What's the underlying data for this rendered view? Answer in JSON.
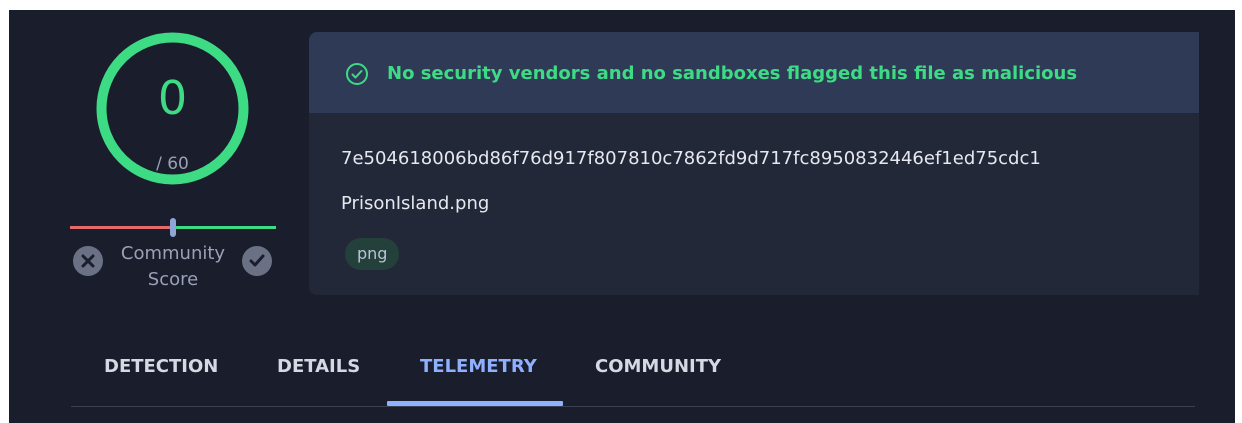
{
  "score": {
    "detections": "0",
    "total": "/ 60",
    "ring_color": "#3ddc84"
  },
  "community": {
    "label_line1": "Community",
    "label_line2": "Score",
    "downvote_icon": "close-icon",
    "upvote_icon": "check-icon"
  },
  "summary": {
    "verdict": "No security vendors and no sandboxes flagged this file as malicious",
    "verdict_icon": "check-circle-icon",
    "verdict_color": "#3ddc84",
    "hash": "7e504618006bd86f76d917f807810c7862fd9d717fc8950832446ef1ed75cdc1",
    "filename": "PrisonIsland.png",
    "tags": [
      "png"
    ]
  },
  "tabs": {
    "items": [
      {
        "label": "DETECTION"
      },
      {
        "label": "DETAILS"
      },
      {
        "label": "TELEMETRY"
      },
      {
        "label": "COMMUNITY"
      }
    ],
    "active": "TELEMETRY",
    "accent": "#8fb0ff"
  }
}
